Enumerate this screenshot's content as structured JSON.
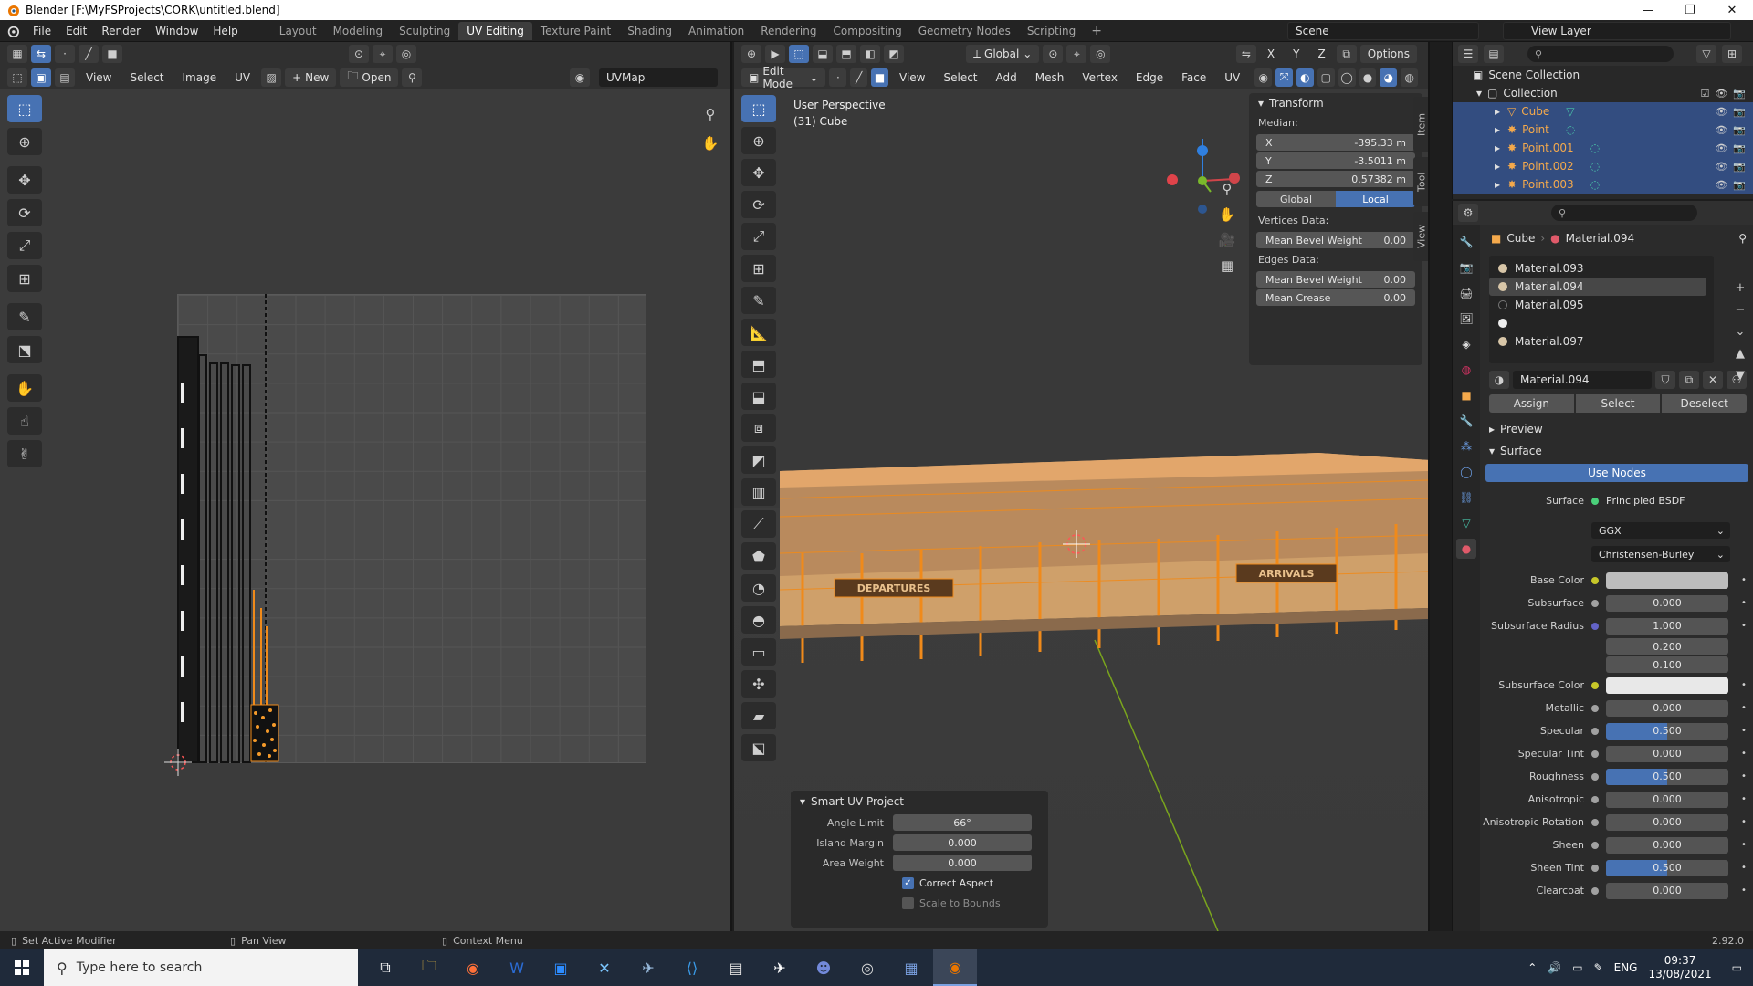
{
  "window": {
    "title": "Blender [F:\\MyFSProjects\\CORK\\untitled.blend]"
  },
  "menu": [
    "File",
    "Edit",
    "Render",
    "Window",
    "Help"
  ],
  "workspaces": [
    {
      "label": "Layout"
    },
    {
      "label": "Modeling"
    },
    {
      "label": "Sculpting"
    },
    {
      "label": "UV Editing",
      "active": true
    },
    {
      "label": "Texture Paint"
    },
    {
      "label": "Shading"
    },
    {
      "label": "Animation"
    },
    {
      "label": "Rendering"
    },
    {
      "label": "Compositing"
    },
    {
      "label": "Geometry Nodes"
    },
    {
      "label": "Scripting"
    }
  ],
  "scene": "Scene",
  "view_layer": "View Layer",
  "uv_editor": {
    "menus": [
      "View",
      "Select",
      "Image",
      "UV"
    ],
    "new_label": "New",
    "open_label": "Open",
    "uvmap": "UVMap"
  },
  "viewport": {
    "mode": "Edit Mode",
    "menus": [
      "View",
      "Select",
      "Add",
      "Mesh",
      "Vertex",
      "Edge",
      "Face",
      "UV"
    ],
    "orientation": "Global",
    "options_label": "Options",
    "info_line1": "User Perspective",
    "info_line2": "(31) Cube",
    "sign_left": "DEPARTURES",
    "sign_right": "ARRIVALS",
    "transform": {
      "title": "Transform",
      "median_label": "Median:",
      "x_label": "X",
      "x": "-395.33 m",
      "y_label": "Y",
      "y": "-3.5011 m",
      "z_label": "Z",
      "z": "0.57382 m",
      "global": "Global",
      "local": "Local",
      "vertices_data": "Vertices Data:",
      "mean_bevel_weight_label": "Mean Bevel Weight",
      "vert_bevel": "0.00",
      "edges_data": "Edges Data:",
      "edge_bevel": "0.00",
      "mean_crease_label": "Mean Crease",
      "crease": "0.00"
    },
    "side_tabs": [
      "Item",
      "Tool",
      "View"
    ],
    "smart_uv": {
      "title": "Smart UV Project",
      "angle_limit_label": "Angle Limit",
      "angle_limit": "66°",
      "island_margin_label": "Island Margin",
      "island_margin": "0.000",
      "area_weight_label": "Area Weight",
      "area_weight": "0.000",
      "correct_aspect_label": "Correct Aspect",
      "correct_aspect": true,
      "scale_to_bounds_label": "Scale to Bounds",
      "scale_to_bounds": false
    }
  },
  "outliner": {
    "scene_collection": "Scene Collection",
    "collection": "Collection",
    "items": [
      {
        "name": "Cube",
        "selected": true
      },
      {
        "name": "Point"
      },
      {
        "name": "Point.001"
      },
      {
        "name": "Point.002"
      },
      {
        "name": "Point.003"
      }
    ]
  },
  "properties": {
    "object": "Cube",
    "material": "Material.094",
    "slots": [
      "Material.093",
      "Material.094",
      "Material.095",
      "",
      "Material.097"
    ],
    "active_slot": "Material.094",
    "assign": "Assign",
    "select": "Select",
    "deselect": "Deselect",
    "preview": "Preview",
    "surface_section": "Surface",
    "use_nodes": "Use Nodes",
    "surface_label": "Surface",
    "surface_shader": "Principled BSDF",
    "distribution": "GGX",
    "subsurface_method": "Christensen-Burley",
    "params": [
      {
        "label": "Base Color",
        "value": "",
        "kind": "color-grey",
        "dot": "y"
      },
      {
        "label": "Subsurface",
        "value": "0.000",
        "dot": "g"
      },
      {
        "label": "Subsurface Radius",
        "value": "1.000",
        "dot": "b"
      },
      {
        "label": "",
        "value": "0.200",
        "kind": "sub"
      },
      {
        "label": "",
        "value": "0.100",
        "kind": "sub"
      },
      {
        "label": "Subsurface Color",
        "value": "",
        "kind": "color-white",
        "dot": "y"
      },
      {
        "label": "Metallic",
        "value": "0.000",
        "dot": "g"
      },
      {
        "label": "Specular",
        "value": "0.500",
        "fill": 0.5,
        "dot": "g"
      },
      {
        "label": "Specular Tint",
        "value": "0.000",
        "dot": "g"
      },
      {
        "label": "Roughness",
        "value": "0.500",
        "fill": 0.5,
        "dot": "g"
      },
      {
        "label": "Anisotropic",
        "value": "0.000",
        "dot": "g"
      },
      {
        "label": "Anisotropic Rotation",
        "value": "0.000",
        "dot": "g"
      },
      {
        "label": "Sheen",
        "value": "0.000",
        "dot": "g"
      },
      {
        "label": "Sheen Tint",
        "value": "0.500",
        "fill": 0.5,
        "dot": "g"
      },
      {
        "label": "Clearcoat",
        "value": "0.000",
        "dot": "g"
      }
    ]
  },
  "status": {
    "left": "Set Active Modifier",
    "middle": "Pan View",
    "right": "Context Menu",
    "version": "2.92.0"
  },
  "taskbar": {
    "search_placeholder": "Type here to search",
    "language": "ENG",
    "time": "09:37",
    "date": "13/08/2021"
  },
  "colors": {
    "accent": "#4772b3",
    "selected_orange": "#f4a94c"
  }
}
